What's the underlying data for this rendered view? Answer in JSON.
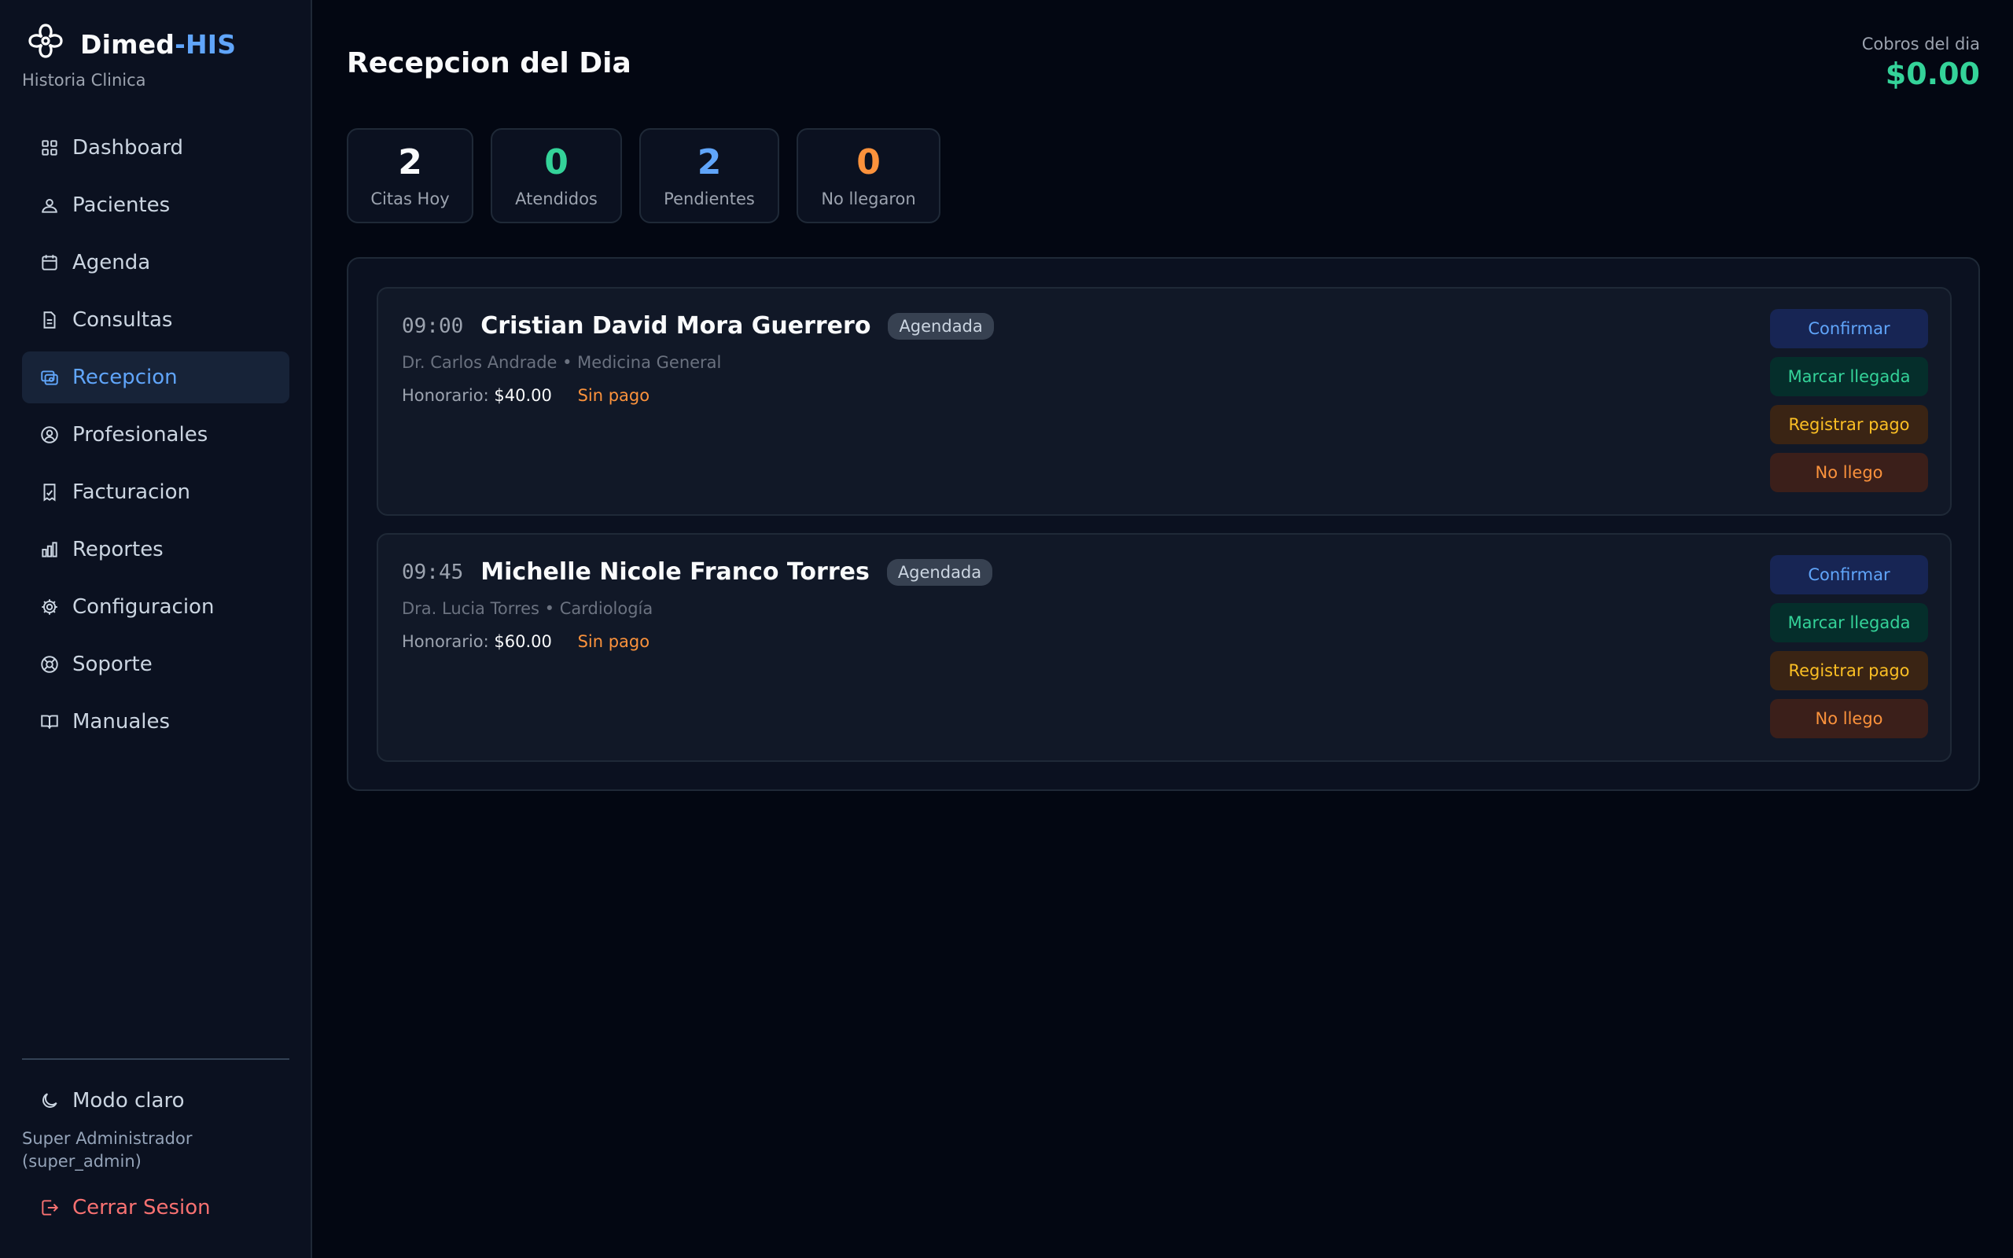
{
  "app": {
    "brand_main": "Dimed",
    "brand_accent": "-HIS",
    "subtitle": "Historia Clinica"
  },
  "sidebar": {
    "items": [
      {
        "label": "Dashboard",
        "icon": "grid-icon",
        "active": false
      },
      {
        "label": "Pacientes",
        "icon": "user-icon",
        "active": false
      },
      {
        "label": "Agenda",
        "icon": "calendar-icon",
        "active": false
      },
      {
        "label": "Consultas",
        "icon": "document-icon",
        "active": false
      },
      {
        "label": "Recepcion",
        "icon": "reception-icon",
        "active": true
      },
      {
        "label": "Profesionales",
        "icon": "user-circle-icon",
        "active": false
      },
      {
        "label": "Facturacion",
        "icon": "receipt-icon",
        "active": false
      },
      {
        "label": "Reportes",
        "icon": "bar-chart-icon",
        "active": false
      },
      {
        "label": "Configuracion",
        "icon": "gear-icon",
        "active": false
      },
      {
        "label": "Soporte",
        "icon": "lifebuoy-icon",
        "active": false
      },
      {
        "label": "Manuales",
        "icon": "book-icon",
        "active": false
      }
    ],
    "mode_toggle": "Modo claro",
    "user_line1": "Super Administrador",
    "user_line2": "(super_admin)",
    "logout": "Cerrar Sesion"
  },
  "header": {
    "title": "Recepcion del Dia",
    "cobros_label": "Cobros del dia",
    "cobros_value": "$0.00"
  },
  "stats": [
    {
      "value": "2",
      "label": "Citas Hoy",
      "color": "#f9fafb"
    },
    {
      "value": "0",
      "label": "Atendidos",
      "color": "#34d399"
    },
    {
      "value": "2",
      "label": "Pendientes",
      "color": "#60a5fa"
    },
    {
      "value": "0",
      "label": "No llegaron",
      "color": "#fb923c"
    }
  ],
  "appointments": [
    {
      "time": "09:00",
      "patient": "Cristian David Mora Guerrero",
      "status": "Agendada",
      "doctor": "Dr. Carlos Andrade • Medicina General",
      "fee_label": "Honorario:",
      "fee": "$40.00",
      "payment": "Sin pago"
    },
    {
      "time": "09:45",
      "patient": "Michelle Nicole Franco Torres",
      "status": "Agendada",
      "doctor": "Dra. Lucia Torres • Cardiología",
      "fee_label": "Honorario:",
      "fee": "$60.00",
      "payment": "Sin pago"
    }
  ],
  "actions": {
    "confirm": "Confirmar",
    "arrive": "Marcar llegada",
    "pay": "Registrar pago",
    "noshow": "No llego"
  },
  "colors": {
    "background": "#030712",
    "sidebar": "#0b1120",
    "accent": "#60a5fa",
    "success": "#34d399",
    "warning": "#fb923c",
    "danger": "#f87171"
  }
}
